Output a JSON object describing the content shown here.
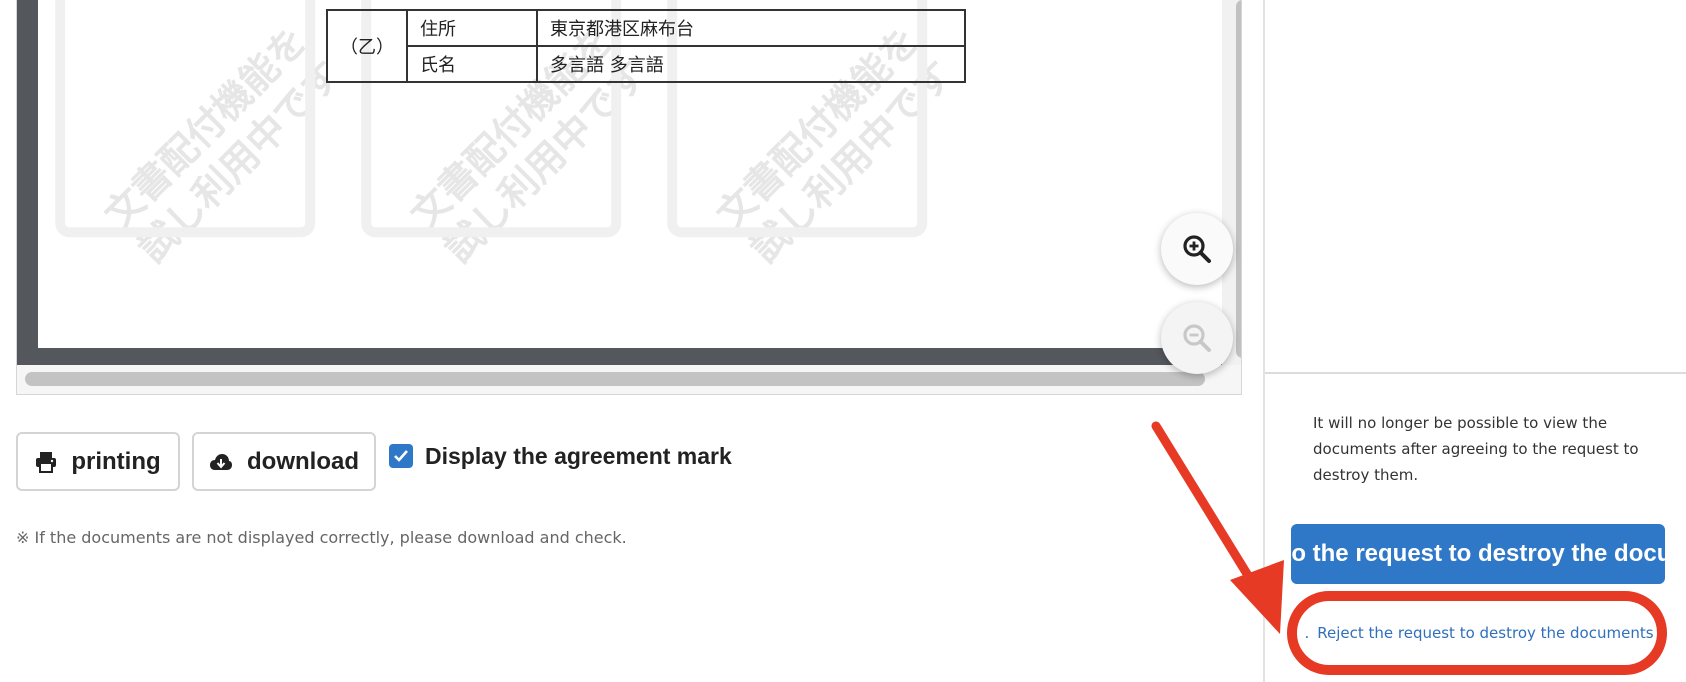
{
  "document": {
    "table": {
      "side_label": "（乙）",
      "rows": [
        {
          "key": "住所",
          "value": "東京都港区麻布台"
        },
        {
          "key": "氏名",
          "value": "多言語  多言語"
        }
      ]
    },
    "watermark_line1": "文書配付機能を",
    "watermark_line2": "試し利用中です"
  },
  "viewer": {
    "zoom_in_icon": "zoom-in-icon",
    "zoom_out_icon": "zoom-out-icon"
  },
  "toolbar": {
    "print_label": "printing",
    "download_label": "download",
    "agreement_mark_label": "Display the agreement mark",
    "agreement_mark_checked": true
  },
  "note": "※ If the documents are not displayed correctly, please download and check.",
  "right_panel": {
    "info_text": "It will no longer be possible to view the documents after agreeing to the request to destroy them.",
    "agree_button": "e to the request to destroy the docum",
    "reject_button": "Reject the request to destroy the documents",
    "reject_marker": "."
  },
  "colors": {
    "accent": "#2f78c8",
    "annotation": "#e63a25",
    "viewer_bg": "#54585d"
  }
}
